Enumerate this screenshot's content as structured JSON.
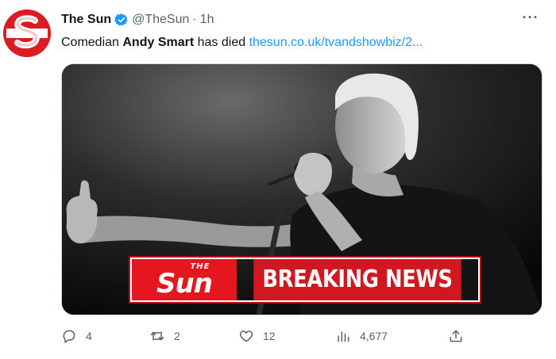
{
  "tweet": {
    "display_name": "The Sun",
    "handle": "@TheSun",
    "separator": "·",
    "time": "1h",
    "more_label": "···",
    "text_before": "Comedian ",
    "text_bold": "Andy Smart",
    "text_after": " has died ",
    "link_text": "thesun.co.uk/tvandshowbiz/2..."
  },
  "media": {
    "banner_logo_small": "THE",
    "banner_logo_big": "Sun",
    "banner_text": "BREAKING NEWS"
  },
  "actions": {
    "replies": "4",
    "retweets": "2",
    "likes": "12",
    "views": "4,677"
  },
  "colors": {
    "brand_red": "#d81e23",
    "link_blue": "#1d9bf0",
    "verified_blue": "#1d9bf0",
    "muted": "#536471"
  }
}
